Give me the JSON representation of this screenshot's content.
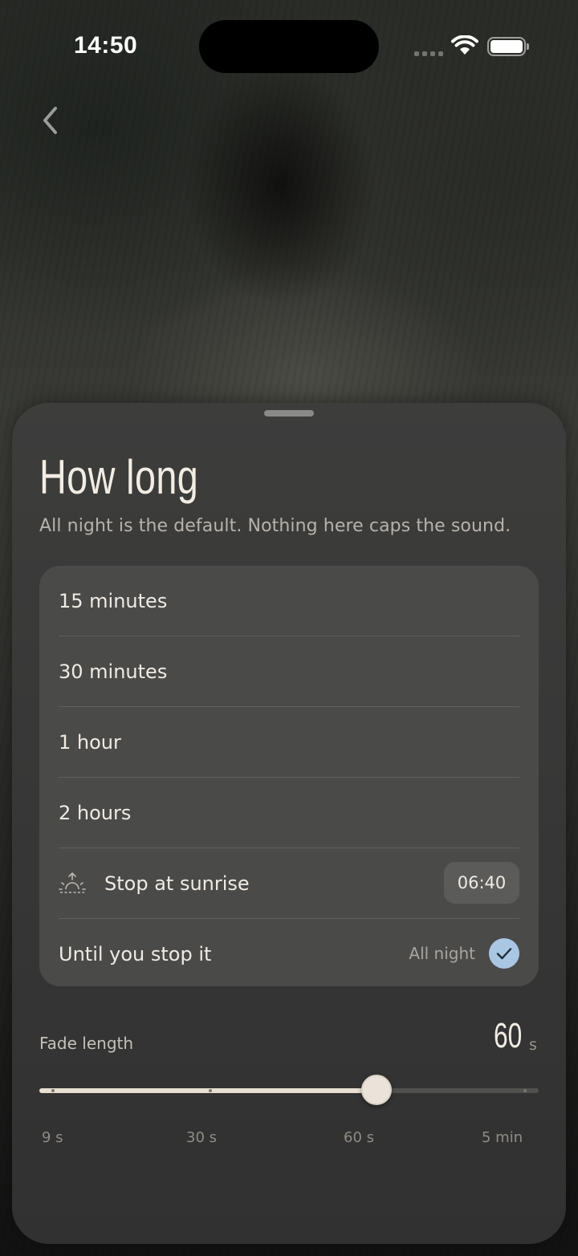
{
  "status_bar": {
    "time": "14:50"
  },
  "header": {
    "back_icon": "chevron-left-icon"
  },
  "sheet": {
    "title": "How long",
    "subtitle": "All night is the default. Nothing here caps the sound.",
    "options": [
      {
        "label": "15 minutes"
      },
      {
        "label": "30 minutes"
      },
      {
        "label": "1 hour"
      },
      {
        "label": "2 hours"
      },
      {
        "label": "Stop at sunrise",
        "icon": "sunrise-icon",
        "time": "06:40"
      },
      {
        "label": "Until you stop it",
        "tag": "All night",
        "selected": true
      }
    ],
    "fade": {
      "label": "Fade length",
      "value": "60",
      "unit": "s",
      "stops": [
        "9 s",
        "30 s",
        "60 s",
        "5 min"
      ],
      "selected_stop_index": 2
    }
  },
  "colors": {
    "accent_check": "#a9c6e3",
    "slider_fill": "#e8e1d2",
    "sheet_bg": "#3b3b3a"
  }
}
